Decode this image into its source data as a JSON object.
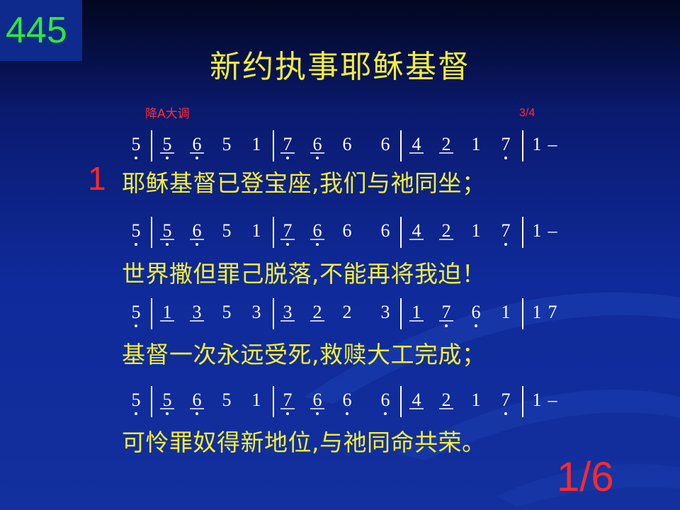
{
  "hymn_number": "445",
  "title": "新约执事耶稣基督",
  "key": "降A大调",
  "time_signature": "3/4",
  "verse_number": "1",
  "page_indicator": "1/6",
  "lines": [
    {
      "notation": "5 | 5 6 5 1 | 7 6 6 6 | 4 2 1 7 | 1 -",
      "lyric": "耶稣基督已登宝座,我们与祂同坐；"
    },
    {
      "notation": "5 | 5 6 5 1 | 7 6 6 6 | 4 2 1 7 | 1 -",
      "lyric": "世界撒但罪己脱落,不能再将我迫！"
    },
    {
      "notation": "5 | 1 3 5 3 | 3 2 2 3 | 1 7 6 1 | 1 7",
      "lyric": "基督一次永远受死,救赎大工完成；"
    },
    {
      "notation": "5 | 5 6 5 1 | 7 6 6 6 | 4 2 1 7 | 1 - ‖",
      "lyric": "可怜罪奴得新地位,与祂同命共荣。"
    }
  ],
  "colors": {
    "title": "#f2ee3a",
    "lyric": "#f2ee3a",
    "notes": "#ffffff",
    "accent_red": "#ff2a2a",
    "number_green": "#2fe838"
  }
}
